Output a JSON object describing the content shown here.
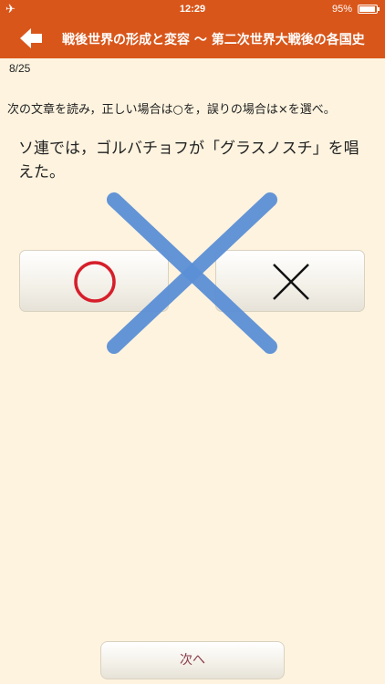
{
  "status_bar": {
    "time": "12:29",
    "battery": "95%",
    "battery_level": 0.95,
    "airplane_icon": "airplane-icon"
  },
  "nav": {
    "back_icon": "back-arrow-icon",
    "title": "戦後世界の形成と変容 〜 第二次世界大戦後の各国史"
  },
  "quiz": {
    "progress": "8/25",
    "instruction": "次の文章を読み，正しい場合は○を，誤りの場合は×を選べ。",
    "question": "ソ連では，ゴルバチョフが「グラスノスチ」を唱えた。",
    "answer_true_icon": "circle-icon",
    "answer_false_icon": "cross-icon",
    "result_mark_icon": "big-cross-icon",
    "next_label": "次へ"
  },
  "colors": {
    "header": "#d9561a",
    "background": "#fdf3df",
    "circle": "#d61f2b",
    "result_cross": "#5b8fd6"
  }
}
